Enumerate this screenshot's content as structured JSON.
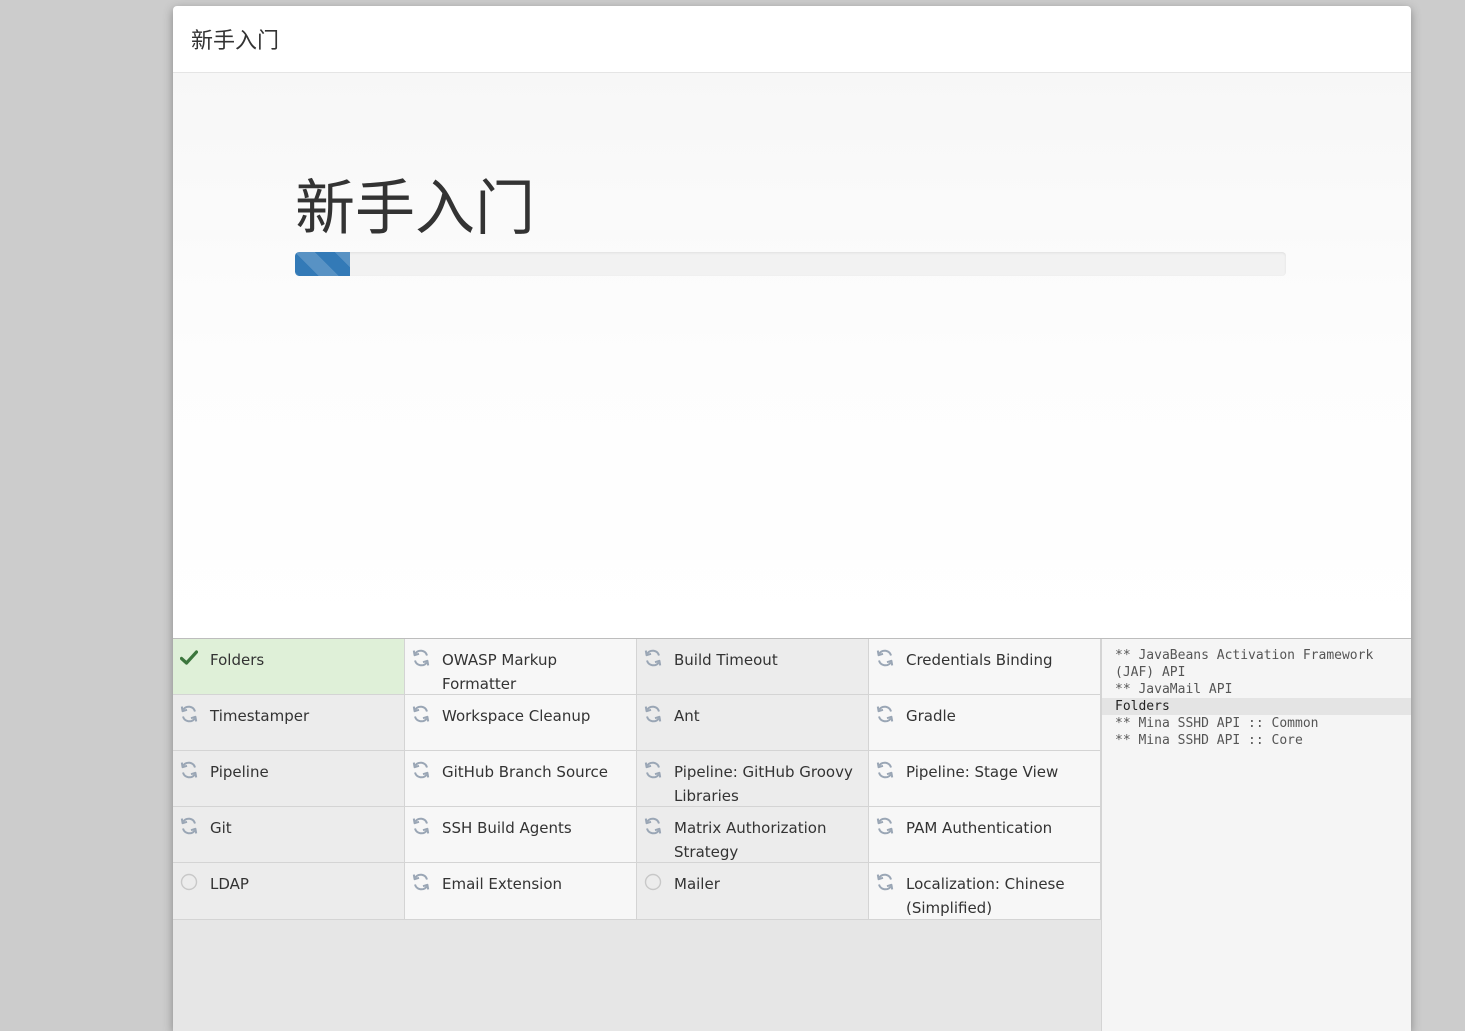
{
  "dialog": {
    "header_title": "新手入门"
  },
  "hero": {
    "title": "新手入门",
    "progress_fraction": 0.056,
    "progress_color": "#337ab7"
  },
  "plugins": [
    {
      "name": "Folders",
      "status": "success",
      "icon": "check-icon"
    },
    {
      "name": "OWASP Markup Formatter",
      "status": "pending",
      "icon": "refresh-icon"
    },
    {
      "name": "Build Timeout",
      "status": "pending",
      "icon": "refresh-icon"
    },
    {
      "name": "Credentials Binding",
      "status": "pending",
      "icon": "refresh-icon"
    },
    {
      "name": "Timestamper",
      "status": "pending",
      "icon": "refresh-icon"
    },
    {
      "name": "Workspace Cleanup",
      "status": "pending",
      "icon": "refresh-icon"
    },
    {
      "name": "Ant",
      "status": "pending",
      "icon": "refresh-icon"
    },
    {
      "name": "Gradle",
      "status": "pending",
      "icon": "refresh-icon"
    },
    {
      "name": "Pipeline",
      "status": "pending",
      "icon": "refresh-icon"
    },
    {
      "name": "GitHub Branch Source",
      "status": "pending",
      "icon": "refresh-icon"
    },
    {
      "name": "Pipeline: GitHub Groovy Libraries",
      "status": "pending",
      "icon": "refresh-icon"
    },
    {
      "name": "Pipeline: Stage View",
      "status": "pending",
      "icon": "refresh-icon"
    },
    {
      "name": "Git",
      "status": "pending",
      "icon": "refresh-icon"
    },
    {
      "name": "SSH Build Agents",
      "status": "pending",
      "icon": "refresh-icon"
    },
    {
      "name": "Matrix Authorization Strategy",
      "status": "pending",
      "icon": "refresh-icon"
    },
    {
      "name": "PAM Authentication",
      "status": "pending",
      "icon": "refresh-icon"
    },
    {
      "name": "LDAP",
      "status": "waiting",
      "icon": "circle-icon"
    },
    {
      "name": "Email Extension",
      "status": "pending",
      "icon": "refresh-icon"
    },
    {
      "name": "Mailer",
      "status": "waiting",
      "icon": "circle-icon"
    },
    {
      "name": "Localization: Chinese (Simplified)",
      "status": "pending",
      "icon": "refresh-icon"
    }
  ],
  "log": [
    {
      "text": "** JavaBeans Activation Framework (JAF) API",
      "current": false
    },
    {
      "text": "** JavaMail API",
      "current": false
    },
    {
      "text": "Folders",
      "current": true
    },
    {
      "text": "** Mina SSHD API :: Common",
      "current": false
    },
    {
      "text": "** Mina SSHD API :: Core",
      "current": false
    }
  ],
  "colors": {
    "success_bg": "#dff0d8",
    "check": "#3c763d",
    "pending_icon": "#9aa6b5",
    "waiting_icon": "#c8c8c8"
  }
}
